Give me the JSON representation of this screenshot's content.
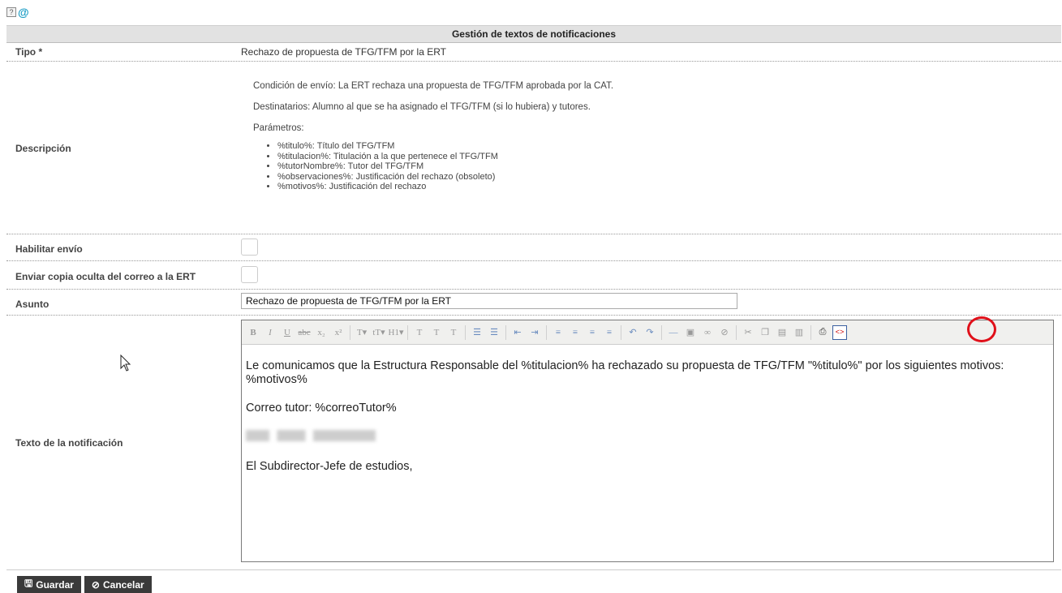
{
  "top_icons": [
    "help-icon",
    "at-email-icon"
  ],
  "header": {
    "title": "Gestión de textos de notificaciones"
  },
  "fields": {
    "tipo": {
      "label": "Tipo *",
      "value": "Rechazo de propuesta de TFG/TFM por la ERT"
    },
    "descripcion": {
      "label": "Descripción",
      "condicion": "Condición de envío: La ERT rechaza una propuesta de TFG/TFM aprobada por la CAT.",
      "destinatarios": "Destinatarios: Alumno al que se ha asignado el TFG/TFM (si lo hubiera) y tutores.",
      "parametros_label": "Parámetros:",
      "parametros": [
        "%titulo%: Título del TFG/TFM",
        "%titulacion%: Titulación a la que pertenece el TFG/TFM",
        "%tutorNombre%: Tutor del TFG/TFM",
        "%observaciones%: Justificación del rechazo (obsoleto)",
        "%motivos%: Justificación del rechazo"
      ]
    },
    "habilitar": {
      "label": "Habilitar envío",
      "checked": false
    },
    "copia_oculta": {
      "label": "Enviar copia oculta del correo a la ERT",
      "checked": false
    },
    "asunto": {
      "label": "Asunto",
      "value": "Rechazo de propuesta de TFG/TFM por la ERT"
    },
    "texto": {
      "label": "Texto de la notificación",
      "paragraph1": "Le comunicamos que la Estructura Responsable del %titulacion% ha rechazado su propuesta de TFG/TFM \"%titulo%\" por los siguientes motivos: %motivos%",
      "paragraph2": "Correo tutor: %correoTutor%",
      "paragraph4": "El Subdirector-Jefe de estudios,"
    }
  },
  "toolbar_icons": [
    "bold-icon",
    "italic-icon",
    "underline-icon",
    "strikethrough-icon",
    "subscript-icon",
    "superscript-icon",
    "font-family-icon",
    "font-size-icon",
    "heading-icon",
    "text-color-icon",
    "highlight-icon",
    "clear-format-icon",
    "bullet-list-icon",
    "numbered-list-icon",
    "outdent-icon",
    "indent-icon",
    "align-left-icon",
    "align-center-icon",
    "align-right-icon",
    "justify-icon",
    "undo-icon",
    "redo-icon",
    "horizontal-rule-icon",
    "image-icon",
    "link-icon",
    "unlink-icon",
    "cut-icon",
    "copy-icon",
    "paste-icon",
    "paste-text-icon",
    "print-icon",
    "source-code-icon"
  ],
  "buttons": {
    "save": "Guardar",
    "cancel": "Cancelar"
  },
  "highlight_color": "#e0101a"
}
